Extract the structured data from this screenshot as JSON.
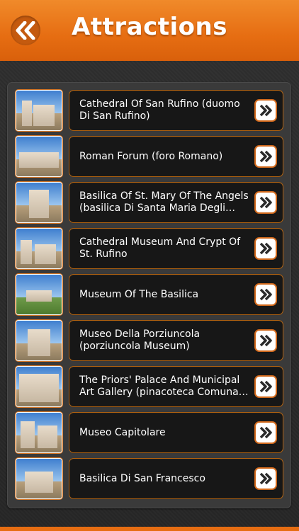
{
  "header": {
    "title": "Attractions",
    "back_icon": "double-chevron-left-icon"
  },
  "colors": {
    "accent": "#e8731a",
    "cell_bg": "#171717",
    "panel_bg": "#3a3a3a"
  },
  "attractions": [
    {
      "label": "Cathedral Of San Rufino (duomo Di San Rufino)",
      "icon": "double-chevron-right-icon"
    },
    {
      "label": "Roman Forum (foro Romano)",
      "icon": "double-chevron-right-icon"
    },
    {
      "label": "Basilica Of St. Mary Of The Angels (basilica Di Santa Maria Degli Angeli)",
      "icon": "double-chevron-right-icon"
    },
    {
      "label": "Cathedral Museum And Crypt Of St. Rufino",
      "icon": "double-chevron-right-icon"
    },
    {
      "label": "Museum Of The Basilica",
      "icon": "double-chevron-right-icon"
    },
    {
      "label": "Museo Della Porziuncola (porziuncola Museum)",
      "icon": "double-chevron-right-icon"
    },
    {
      "label": "The Priors' Palace And Municipal Art Gallery (pinacoteca Comunale Di A...",
      "icon": "double-chevron-right-icon"
    },
    {
      "label": "Museo Capitolare",
      "icon": "double-chevron-right-icon"
    },
    {
      "label": "Basilica Di San Francesco",
      "icon": "double-chevron-right-icon"
    }
  ]
}
